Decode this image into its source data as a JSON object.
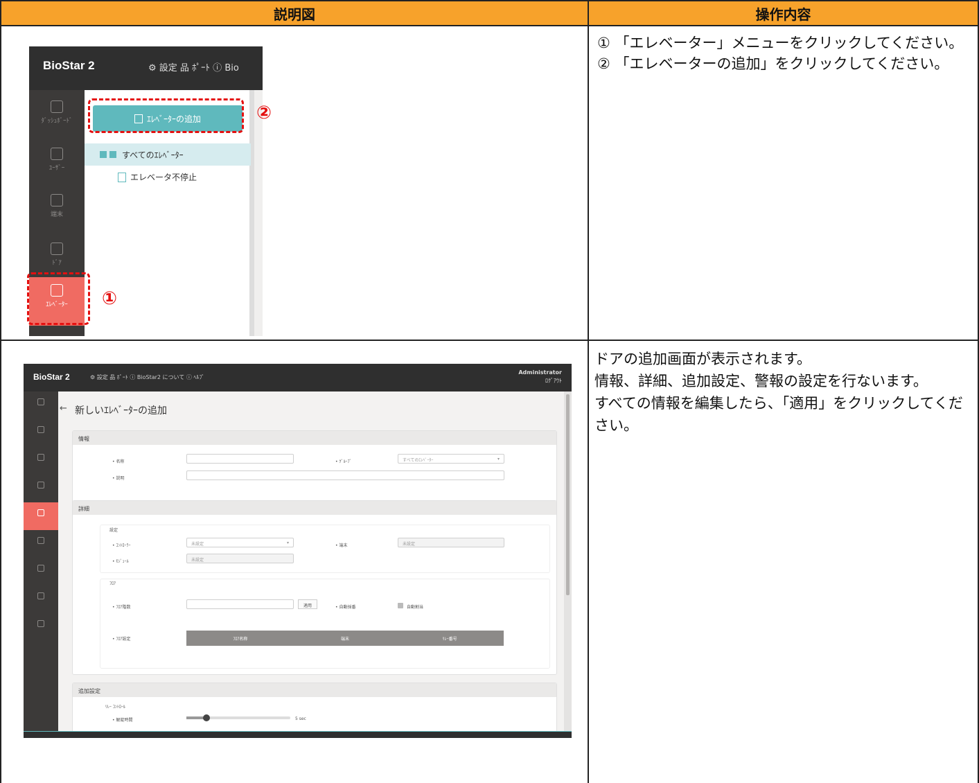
{
  "header": {
    "left": "説明図",
    "right": "操作内容"
  },
  "row1": {
    "instructions": [
      "① 「エレベーター」メニューをクリックしてください。",
      "② 「エレベーターの追加」をクリックしてください。"
    ],
    "markers": {
      "one": "①",
      "two": "②"
    },
    "screenshot": {
      "brand": "BioStar 2",
      "top_icons": "⚙ 設定 品 ﾎﾟｰﾄ ⓘ Bio",
      "sidebar": [
        {
          "label": "ﾀﾞｯｼｭﾎﾞｰﾄﾞ",
          "icon": "gauge-icon"
        },
        {
          "label": "ﾕｰｻﾞｰ",
          "icon": "user-icon"
        },
        {
          "label": "端末",
          "icon": "device-icon"
        },
        {
          "label": "ﾄﾞｱ",
          "icon": "door-icon"
        },
        {
          "label": "ｴﾚﾍﾞｰﾀｰ",
          "icon": "elevator-icon"
        }
      ],
      "add_button": "ｴﾚﾍﾞｰﾀｰの追加",
      "tree_root": "すべてのｴﾚﾍﾞｰﾀｰ",
      "tree_child": "エレベータ不停止"
    }
  },
  "row2": {
    "description": [
      "ドアの追加画面が表示されます。",
      "情報、詳細、追加設定、警報の設定を行ないます。",
      "すべての情報を編集したら、「適用」をクリックしてください。"
    ],
    "screenshot": {
      "brand": "BioStar 2",
      "top_icons": "⚙ 設定 品 ﾎﾟｰﾄ ⓘ BioStar2 について ⓘ ﾍﾙﾌﾟ",
      "admin_name": "Administrator",
      "logout": "ﾛｸﾞｱｳﾄ",
      "page_title": "新しいｴﾚﾍﾞｰﾀｰの追加",
      "back_icon": "←",
      "sections": {
        "info": {
          "title": "情報",
          "name_label": "• 名称",
          "group_label": "• ｸﾞﾙｰﾌﾟ",
          "group_value": "すべてのｴﾚﾍﾞｰﾀｰ",
          "desc_label": "• 説明"
        },
        "detail": {
          "title": "詳細",
          "settings_label": "設定",
          "controller_label": "• ｺﾝﾄﾛｰﾗｰ",
          "controller_value": "未設定",
          "terminal_label": "• 端末",
          "terminal_value": "未設定",
          "module_label": "• ﾓｼﾞｭｰﾙ",
          "module_value": "未設定",
          "floor_label": "ﾌﾛｱ",
          "floor_count_label": "• ﾌﾛｱ階数",
          "apply_button": "適用",
          "auto_number_label": "• 自動採番",
          "auto_assign_label": "自動割当",
          "floor_setting_label": "• ﾌﾛｱ設定",
          "table_headers": [
            "ﾌﾛｱ名称",
            "端末",
            "ﾘﾚｰ番号"
          ]
        },
        "extra": {
          "title": "追加設定",
          "relay_label": "ﾘﾚｰ ｺﾝﾄﾛｰﾙ",
          "unlock_label": "• 解錠時間",
          "unlock_value": "5 sec"
        }
      }
    }
  }
}
